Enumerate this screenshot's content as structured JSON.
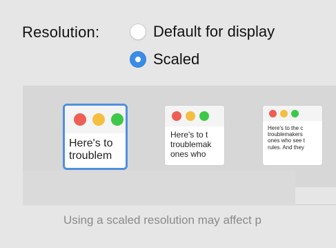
{
  "resolution": {
    "label": "Resolution:",
    "options": [
      {
        "label": "Default for display",
        "selected": false
      },
      {
        "label": "Scaled",
        "selected": true
      }
    ]
  },
  "previews": [
    {
      "lines": [
        "Here's to",
        "troublem"
      ],
      "selected": true
    },
    {
      "lines": [
        "Here's to t",
        "troublemak",
        "ones who"
      ],
      "selected": false
    },
    {
      "lines": [
        "Here's to the c",
        "troublemakers",
        "ones who see t",
        "rules. And they"
      ],
      "selected": false
    }
  ],
  "footnote": "Using a scaled resolution may affect p",
  "colors": {
    "accent": "#3b8ce6",
    "close": "#ee5e55",
    "minimize": "#f4be3f",
    "zoom": "#3ec848"
  }
}
